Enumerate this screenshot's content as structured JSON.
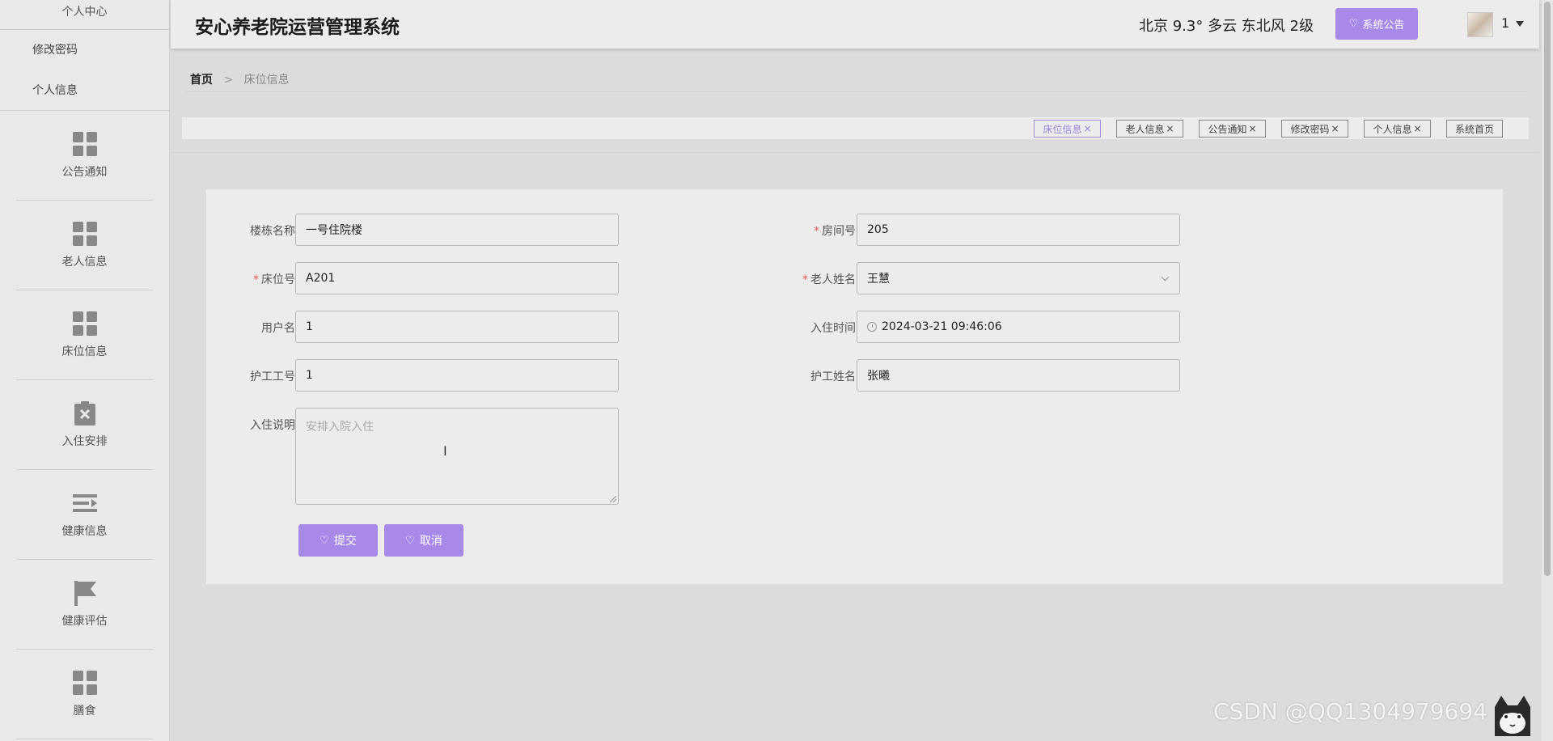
{
  "app": {
    "title": "安心养老院运营管理系统",
    "weather": "北京  9.3°  多云  东北风  2级",
    "notice_button": "系统公告",
    "user_name": "1"
  },
  "sidebar": {
    "section": "个人中心",
    "sub_items": [
      "修改密码",
      "个人信息"
    ],
    "items": [
      {
        "label": "公告通知",
        "icon": "grid-icon"
      },
      {
        "label": "老人信息",
        "icon": "grid-icon"
      },
      {
        "label": "床位信息",
        "icon": "grid-icon"
      },
      {
        "label": "入住安排",
        "icon": "clipboard-x-icon"
      },
      {
        "label": "健康信息",
        "icon": "list-indent-icon"
      },
      {
        "label": "健康评估",
        "icon": "flag-icon"
      },
      {
        "label": "膳食",
        "icon": "grid-icon"
      }
    ]
  },
  "breadcrumb": {
    "home": "首页",
    "separator": ">",
    "current": "床位信息"
  },
  "tags": [
    {
      "label": "床位信息",
      "active": true
    },
    {
      "label": "老人信息",
      "active": false
    },
    {
      "label": "公告通知",
      "active": false
    },
    {
      "label": "修改密码",
      "active": false
    },
    {
      "label": "个人信息",
      "active": false
    },
    {
      "label": "系统首页",
      "active": false
    }
  ],
  "form": {
    "building_label": "楼栋名称",
    "building_value": "一号住院楼",
    "room_label": "房间号",
    "room_value": "205",
    "bed_label": "床位号",
    "bed_value": "A201",
    "elder_label": "老人姓名",
    "elder_value": "王慧",
    "username_label": "用户名",
    "username_value": "1",
    "checkin_time_label": "入住时间",
    "checkin_time_value": "2024-03-21 09:46:06",
    "nurse_id_label": "护工工号",
    "nurse_id_value": "1",
    "nurse_name_label": "护工姓名",
    "nurse_name_value": "张曦",
    "note_label": "入住说明",
    "note_placeholder": "安排入院入住",
    "submit_label": "提交",
    "cancel_label": "取消",
    "required_mark": "*"
  },
  "watermark": "CSDN @QQ1304979694",
  "colors": {
    "accent": "#a889e8",
    "required": "#e05a5a"
  }
}
